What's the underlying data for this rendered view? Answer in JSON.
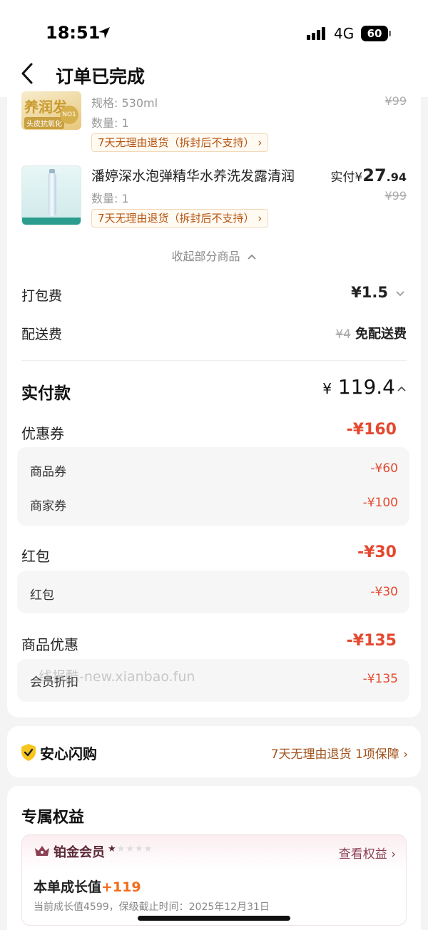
{
  "status_bar": {
    "time": "18:51",
    "network": "4G",
    "battery": "60"
  },
  "nav": {
    "title": "订单已完成"
  },
  "products": [
    {
      "thumb_text": "养润发",
      "thumb_badge": "头皮抗氧化",
      "thumb_seal": "NO1",
      "spec": "规格: 530ml",
      "quantity": "数量: 1",
      "return_policy": "7天无理由退货（拆封后不支持）",
      "original_price": "¥99"
    },
    {
      "name": "潘婷深水泡弹精华水养洗发露清润",
      "paid_label": "实付",
      "paid_currency": "¥",
      "paid_int": "27",
      "paid_dec": ".94",
      "quantity": "数量: 1",
      "return_policy": "7天无理由退货（拆封后不支持）",
      "original_price": "¥99"
    }
  ],
  "collapse_text": "收起部分商品",
  "fees": {
    "packing": {
      "label": "打包费",
      "amount": "¥1.5"
    },
    "delivery": {
      "label": "配送费",
      "original": "¥4",
      "value": "免配送费"
    }
  },
  "total": {
    "label": "实付款",
    "currency": "¥",
    "amount": "119.4"
  },
  "discounts": [
    {
      "label": "优惠券",
      "amount": "-¥160",
      "items": [
        {
          "label": "商品券",
          "amount": "-¥60"
        },
        {
          "label": "商家券",
          "amount": "-¥100"
        }
      ]
    },
    {
      "label": "红包",
      "amount": "-¥30",
      "items": [
        {
          "label": "红包",
          "amount": "-¥30"
        }
      ]
    },
    {
      "label": "商品优惠",
      "amount": "-¥135",
      "items": [
        {
          "label": "会员折扣",
          "amount": "-¥135"
        }
      ]
    }
  ],
  "watermark": "线报酷-new.xianbao.fun",
  "assurance": {
    "title": "安心闪购",
    "detail": "7天无理由退货 1项保障"
  },
  "benefits": {
    "title": "专属权益",
    "member_level": "铂金会员",
    "stars_filled": 1,
    "stars_total": 5,
    "view_link": "查看权益",
    "growth_label": "本单成长值",
    "growth_value": "+119",
    "growth_detail": "当前成长值4599，保级截止时间：2025年12月31日"
  },
  "colors": {
    "discount_red": "#e4482f",
    "member_purple": "#5b2838",
    "accent_orange": "#f26d1d"
  },
  "icons": [
    "location-arrow-icon",
    "signal-icon",
    "battery-icon",
    "back-arrow-icon",
    "chevron-up-icon",
    "chevron-down-icon",
    "chevron-right-icon",
    "shield-check-icon",
    "crown-icon",
    "star-icon"
  ]
}
